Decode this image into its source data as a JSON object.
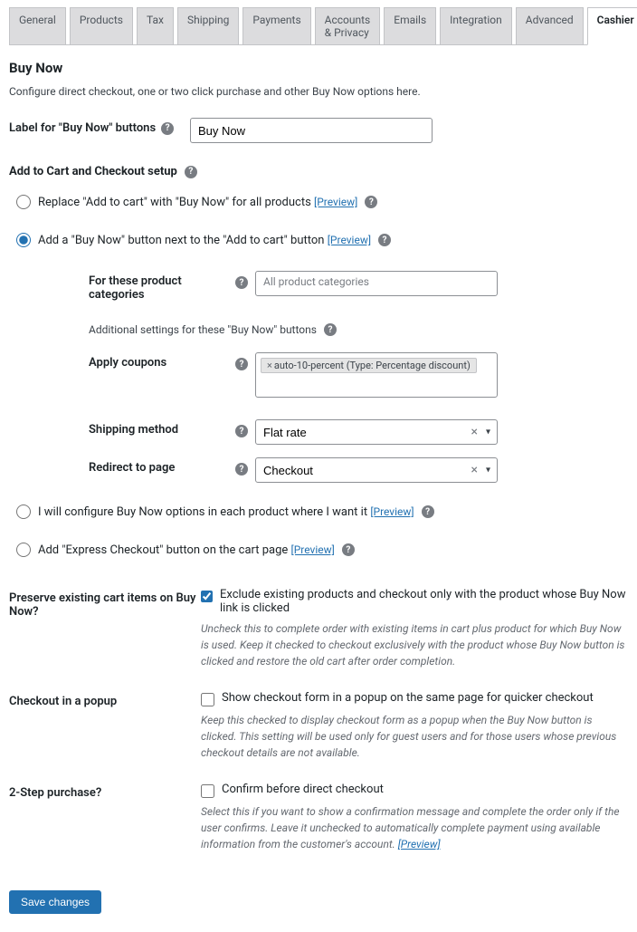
{
  "tabs": [
    "General",
    "Products",
    "Tax",
    "Shipping",
    "Payments",
    "Accounts & Privacy",
    "Emails",
    "Integration",
    "Advanced",
    "Cashier"
  ],
  "active_tab": "Cashier",
  "heading": "Buy Now",
  "subheading": "Configure direct checkout, one or two click purchase and other Buy Now options here.",
  "label_field": {
    "label": "Label for \"Buy Now\" buttons",
    "value": "Buy Now"
  },
  "cart_setup": {
    "title": "Add to Cart and Checkout setup",
    "options": {
      "replace": {
        "label": "Replace \"Add to cart\" with \"Buy Now\" for all products",
        "preview": "[Preview]",
        "checked": false
      },
      "add_next": {
        "label": "Add a \"Buy Now\" button next to the \"Add to cart\" button",
        "preview": "[Preview]",
        "checked": true
      },
      "per_product": {
        "label": "I will configure Buy Now options in each product where I want it",
        "preview": "[Preview]",
        "checked": false
      },
      "express": {
        "label": "Add \"Express Checkout\" button on the cart page",
        "preview": "[Preview]",
        "checked": false
      }
    },
    "sub": {
      "categories": {
        "label": "For these product categories",
        "placeholder": "All product categories"
      },
      "note": "Additional settings for these \"Buy Now\" buttons",
      "coupons": {
        "label": "Apply coupons",
        "tag": "auto-10-percent (Type: Percentage discount)"
      },
      "shipping": {
        "label": "Shipping method",
        "value": "Flat rate"
      },
      "redirect": {
        "label": "Redirect to page",
        "value": "Checkout"
      }
    }
  },
  "preserve": {
    "label": "Preserve existing cart items on Buy Now?",
    "check_label": "Exclude existing products and checkout only with the product whose Buy Now link is clicked",
    "checked": true,
    "hint": "Uncheck this to complete order with existing items in cart plus product for which Buy Now is used. Keep it checked to checkout exclusively with the product whose Buy Now button is clicked and restore the old cart after order completion."
  },
  "popup": {
    "label": "Checkout in a popup",
    "check_label": "Show checkout form in a popup on the same page for quicker checkout",
    "checked": false,
    "hint": "Keep this checked to display checkout form as a popup when the Buy Now button is clicked. This setting will be used only for guest users and for those users whose previous checkout details are not available."
  },
  "twostep": {
    "label": "2-Step purchase?",
    "check_label": "Confirm before direct checkout",
    "checked": false,
    "hint": "Select this if you want to show a confirmation message and complete the order only if the user confirms. Leave it unchecked to automatically complete payment using available information from the customer's account.",
    "preview": "[Preview]"
  },
  "save": "Save changes"
}
